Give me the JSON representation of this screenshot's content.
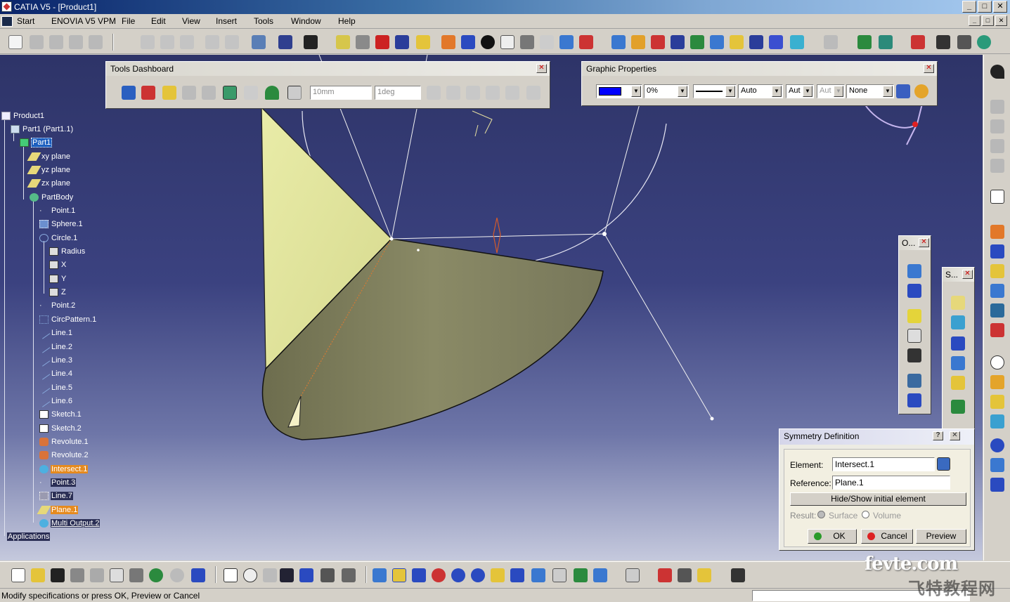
{
  "window": {
    "title": "CATIA V5 - [Product1]",
    "controls": [
      "_",
      "□",
      "✕"
    ]
  },
  "menu": {
    "items": [
      "Start",
      "ENOVIA V5 VPM",
      "File",
      "Edit",
      "View",
      "Insert",
      "Tools",
      "Window",
      "Help"
    ]
  },
  "tools_dashboard": {
    "title": "Tools Dashboard",
    "length_value": "10mm",
    "angle_value": "1deg"
  },
  "graphic_properties": {
    "title": "Graphic Properties",
    "fill_color": "#0000ff",
    "transparency": "0%",
    "line_weight": "Auto",
    "line_type": "Aut",
    "point_type": "Aut",
    "layer": "None"
  },
  "tree": {
    "nodes": [
      {
        "label": "Product1"
      },
      {
        "label": "Part1 (Part1.1)"
      },
      {
        "label": "Part1"
      },
      {
        "label": "xy plane"
      },
      {
        "label": "yz plane"
      },
      {
        "label": "zx plane"
      },
      {
        "label": "PartBody"
      },
      {
        "label": "Point.1"
      },
      {
        "label": "Sphere.1"
      },
      {
        "label": "Circle.1"
      },
      {
        "label": "Radius"
      },
      {
        "label": "X"
      },
      {
        "label": "Y"
      },
      {
        "label": "Z"
      },
      {
        "label": "Point.2"
      },
      {
        "label": "CircPattern.1"
      },
      {
        "label": "Line.1"
      },
      {
        "label": "Line.2"
      },
      {
        "label": "Line.3"
      },
      {
        "label": "Line.4"
      },
      {
        "label": "Line.5"
      },
      {
        "label": "Line.6"
      },
      {
        "label": "Sketch.1"
      },
      {
        "label": "Sketch.2"
      },
      {
        "label": "Revolute.1"
      },
      {
        "label": "Revolute.2"
      },
      {
        "label": "Intersect.1"
      },
      {
        "label": "Point.3"
      },
      {
        "label": "Line.7"
      },
      {
        "label": "Plane.1"
      },
      {
        "label": "Multi Output.2"
      },
      {
        "label": "Applications"
      }
    ]
  },
  "small_toolbars": {
    "o_title": "O...",
    "s_title": "S..."
  },
  "symmetry": {
    "title": "Symmetry Definition",
    "help": "?",
    "element_label": "Element:",
    "element_value": "Intersect.1",
    "reference_label": "Reference:",
    "reference_value": "Plane.1",
    "hide_show_label": "Hide/Show initial element",
    "result_label": "Result:",
    "surface_label": "Surface",
    "volume_label": "Volume",
    "ok_label": "OK",
    "cancel_label": "Cancel",
    "preview_label": "Preview"
  },
  "status": {
    "message": "Modify specifications or press OK, Preview or Cancel"
  },
  "watermark": {
    "site": "fevte.com",
    "brand": "飞特教程网"
  },
  "colors": {
    "viewport_top": "#2e3468",
    "surface_light": "#e6eaaa",
    "surface_dark": "#7a7a5a",
    "selection_blue": "#1c5fbf",
    "highlight_orange": "#e58a1e"
  }
}
